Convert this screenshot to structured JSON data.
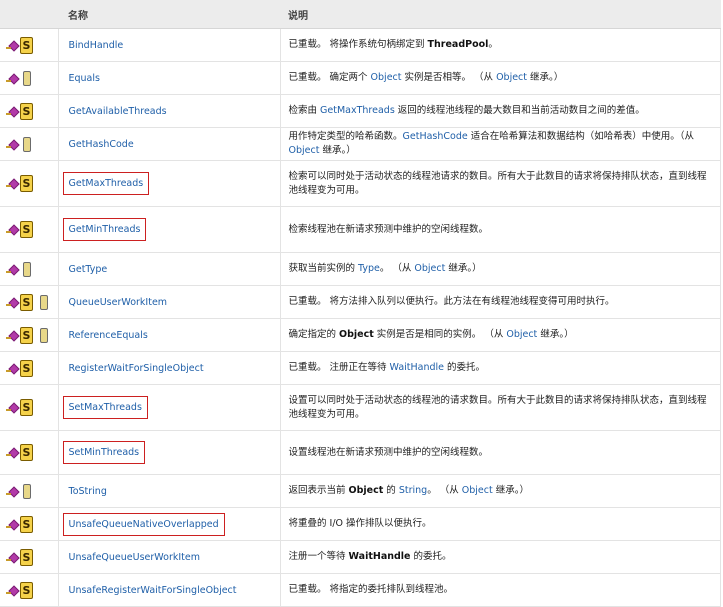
{
  "header": {
    "name": "名称",
    "description": "说明"
  },
  "rows": [
    {
      "icons": [
        "pub",
        "static"
      ],
      "name": "BindHandle",
      "boxed": false,
      "height": 33,
      "desc": [
        {
          "t": "已重载。 将操作系统句柄绑定到 "
        },
        {
          "t": "ThreadPool",
          "b": true
        },
        {
          "t": "。"
        }
      ]
    },
    {
      "icons": [
        "pub",
        "inherit"
      ],
      "name": "Equals",
      "boxed": false,
      "height": 33,
      "desc": [
        {
          "t": "已重载。 确定两个 "
        },
        {
          "t": "Object",
          "l": true
        },
        {
          "t": " 实例是否相等。 （从 "
        },
        {
          "t": "Object",
          "l": true
        },
        {
          "t": " 继承。）"
        }
      ]
    },
    {
      "icons": [
        "pub",
        "static"
      ],
      "name": "GetAvailableThreads",
      "boxed": false,
      "height": 33,
      "desc": [
        {
          "t": "检索由 "
        },
        {
          "t": "GetMaxThreads",
          "l": true
        },
        {
          "t": " 返回的线程池线程的最大数目和当前活动数目之间的差值。"
        }
      ]
    },
    {
      "icons": [
        "pub",
        "inherit"
      ],
      "name": "GetHashCode",
      "boxed": false,
      "height": 33,
      "desc": [
        {
          "t": "用作特定类型的哈希函数。"
        },
        {
          "t": "GetHashCode",
          "l": true
        },
        {
          "t": " 适合在哈希算法和数据结构（如哈希表）中使用。（从 "
        },
        {
          "t": "Object",
          "l": true
        },
        {
          "t": " 继承。）"
        }
      ]
    },
    {
      "icons": [
        "pub",
        "static"
      ],
      "name": "GetMaxThreads",
      "boxed": true,
      "height": 46,
      "desc": [
        {
          "t": "检索可以同时处于活动状态的线程池请求的数目。所有大于此数目的请求将保持排队状态，直到线程池线程变为可用。"
        }
      ]
    },
    {
      "icons": [
        "pub",
        "static"
      ],
      "name": "GetMinThreads",
      "boxed": true,
      "height": 46,
      "desc": [
        {
          "t": "检索线程池在新请求预测中维护的空闲线程数。"
        }
      ]
    },
    {
      "icons": [
        "pub",
        "inherit"
      ],
      "name": "GetType",
      "boxed": false,
      "height": 33,
      "desc": [
        {
          "t": "获取当前实例的 "
        },
        {
          "t": "Type",
          "l": true
        },
        {
          "t": "。 （从 "
        },
        {
          "t": "Object",
          "l": true
        },
        {
          "t": " 继承。）"
        }
      ]
    },
    {
      "icons": [
        "pub",
        "static",
        "inherit"
      ],
      "name": "QueueUserWorkItem",
      "boxed": false,
      "height": 33,
      "desc": [
        {
          "t": "已重载。 将方法排入队列以便执行。此方法在有线程池线程变得可用时执行。"
        }
      ]
    },
    {
      "icons": [
        "pub",
        "static",
        "inherit"
      ],
      "name": "ReferenceEquals",
      "boxed": false,
      "height": 33,
      "desc": [
        {
          "t": "确定指定的 "
        },
        {
          "t": "Object",
          "b": true
        },
        {
          "t": " 实例是否是相同的实例。 （从 "
        },
        {
          "t": "Object",
          "l": true
        },
        {
          "t": " 继承。）"
        }
      ]
    },
    {
      "icons": [
        "pub",
        "static"
      ],
      "name": "RegisterWaitForSingleObject",
      "boxed": false,
      "height": 33,
      "desc": [
        {
          "t": "已重载。 注册正在等待 "
        },
        {
          "t": "WaitHandle",
          "l": true
        },
        {
          "t": " 的委托。"
        }
      ]
    },
    {
      "icons": [
        "pub",
        "static"
      ],
      "name": "SetMaxThreads",
      "boxed": true,
      "height": 46,
      "desc": [
        {
          "t": "设置可以同时处于活动状态的线程池的请求数目。所有大于此数目的请求将保持排队状态，直到线程池线程变为可用。"
        }
      ]
    },
    {
      "icons": [
        "pub",
        "static"
      ],
      "name": "SetMinThreads",
      "boxed": true,
      "height": 44,
      "desc": [
        {
          "t": "设置线程池在新请求预测中维护的空闲线程数。"
        }
      ]
    },
    {
      "icons": [
        "pub",
        "inherit"
      ],
      "name": "ToString",
      "boxed": false,
      "height": 33,
      "desc": [
        {
          "t": "返回表示当前 "
        },
        {
          "t": "Object",
          "b": true
        },
        {
          "t": " 的 "
        },
        {
          "t": "String",
          "l": true
        },
        {
          "t": "。 （从 "
        },
        {
          "t": "Object",
          "l": true
        },
        {
          "t": " 继承。）"
        }
      ]
    },
    {
      "icons": [
        "pub",
        "static"
      ],
      "name": "UnsafeQueueNativeOverlapped",
      "boxed": true,
      "height": 33,
      "desc": [
        {
          "t": "将重叠的 I/O 操作排队以便执行。"
        }
      ]
    },
    {
      "icons": [
        "pub",
        "static"
      ],
      "name": "UnsafeQueueUserWorkItem",
      "boxed": false,
      "height": 33,
      "desc": [
        {
          "t": "注册一个等待 "
        },
        {
          "t": "WaitHandle",
          "b": true
        },
        {
          "t": " 的委托。"
        }
      ]
    },
    {
      "icons": [
        "pub",
        "static"
      ],
      "name": "UnsafeRegisterWaitForSingleObject",
      "boxed": false,
      "height": 33,
      "desc": [
        {
          "t": "已重载。 将指定的委托排队到线程池。"
        }
      ]
    }
  ]
}
